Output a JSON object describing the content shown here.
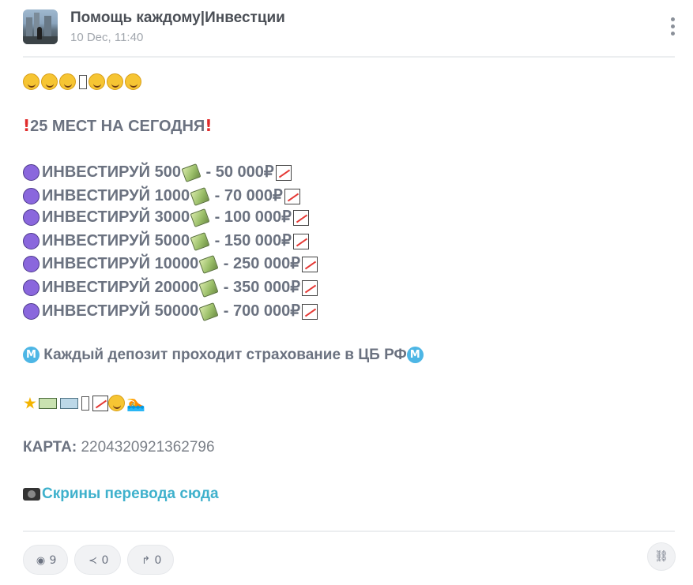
{
  "post": {
    "channel_name": "Помощь каждому|Инвестции",
    "date": "10 Dec, 11:40",
    "headline": "25 МЕСТ НА СЕГОДНЯ",
    "offers": [
      {
        "invest": "ИНВЕСТИРУЙ 500",
        "return": " - 50 000₽"
      },
      {
        "invest": "ИНВЕСТИРУЙ 1000",
        "return": " - 70 000₽"
      },
      {
        "invest": "ИНВЕСТИРУЙ 3000",
        "return": " - 100 000₽"
      },
      {
        "invest": "ИНВЕСТИРУЙ 5000",
        "return": " - 150 000₽"
      },
      {
        "invest": "ИНВЕСТИРУЙ 10000",
        "return": " - 250 000₽"
      },
      {
        "invest": "ИНВЕСТИРУЙ 20000",
        "return": " - 350 000₽"
      },
      {
        "invest": "ИНВЕСТИРУЙ 50000",
        "return": " - 700 000₽"
      }
    ],
    "insurance_text": " Каждый депозит проходит страхование в ЦБ РФ",
    "card_label": "КАРТА:",
    "card_number": " 2204320921362796",
    "link_text": "Скрины перевода сюда",
    "metro_glyph": "M"
  },
  "footer": {
    "views": "9",
    "shares": "0",
    "replies": "0"
  },
  "icons": {
    "views": "eye-icon",
    "shares": "share-icon",
    "replies": "forward-icon",
    "copy_link": "link-icon",
    "more": "more-vertical-icon"
  },
  "colors": {
    "link": "#3fb1cc",
    "text": "#6b7280",
    "violet_circle": "#8a67dd",
    "metro": "#4db6e5"
  }
}
